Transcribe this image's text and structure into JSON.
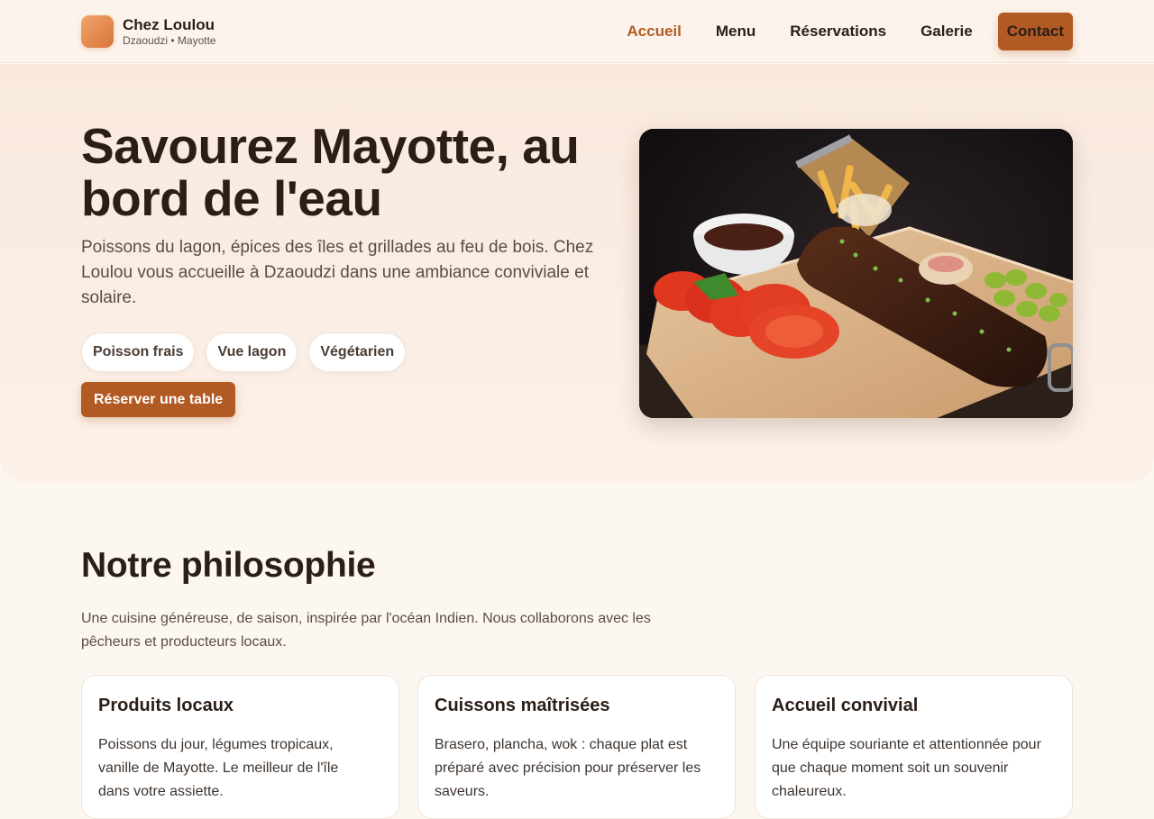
{
  "brand": {
    "name": "Chez Loulou",
    "location": "Dzaoudzi • Mayotte"
  },
  "nav": {
    "items": [
      {
        "label": "Accueil",
        "active": true
      },
      {
        "label": "Menu"
      },
      {
        "label": "Réservations"
      },
      {
        "label": "Galerie"
      }
    ],
    "cta": "Contact"
  },
  "hero": {
    "title": "Savourez Mayotte, au bord de l'eau",
    "subtitle": "Poissons du lagon, épices des îles et grillades au feu de bois. Chez Loulou vous accueille à Dzaoudzi dans une ambiance conviviale et solaire.",
    "tags": [
      "Poisson frais",
      "Vue lagon",
      "Végétarien"
    ],
    "cta": "Réserver une table"
  },
  "philosophy": {
    "title": "Notre philosophie",
    "subtitle": "Une cuisine généreuse, de saison, inspirée par l'océan Indien. Nous collaborons avec les pêcheurs et producteurs locaux.",
    "cards": [
      {
        "title": "Produits locaux",
        "text": "Poissons du jour, légumes tropicaux, vanille de Mayotte. Le meilleur de l'île dans votre assiette."
      },
      {
        "title": "Cuissons maîtrisées",
        "text": "Brasero, plancha, wok : chaque plat est préparé avec précision pour préserver les saveurs."
      },
      {
        "title": "Accueil convivial",
        "text": "Une équipe souriante et attentionnée pour que chaque moment soit un souvenir chaleureux."
      }
    ]
  },
  "colors": {
    "accent": "#b25a24",
    "background": "#fdf7f2",
    "hero_bg": "#f9e9dd",
    "text": "#2a1e17"
  }
}
